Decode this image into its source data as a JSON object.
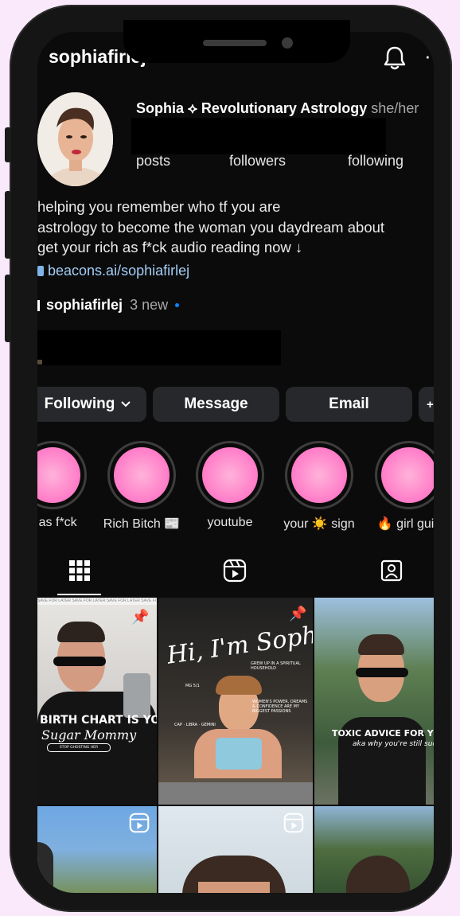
{
  "header": {
    "username": "sophiafirlej",
    "bell_icon": "bell-icon",
    "more_icon": "more-icon"
  },
  "profile": {
    "display_name": "Sophia ⟡ Revolutionary Astrology",
    "pronouns": "she/her",
    "stats": {
      "posts_label": "posts",
      "followers_label": "followers",
      "following_label": "following"
    },
    "bio_lines": [
      "helping you remember who tf you are",
      "astrology to become the woman you daydream about",
      "get your rich as f*ck audio reading now ↓"
    ],
    "link_text": "beacons.ai/sophiafirlej",
    "threads_handle": "sophiafirlej",
    "threads_new": "3 new"
  },
  "actions": {
    "following_label": "Following",
    "message_label": "Message",
    "email_label": "Email"
  },
  "highlights": [
    {
      "label": "h as f*ck"
    },
    {
      "label": "Rich Bitch 📰"
    },
    {
      "label": "youtube"
    },
    {
      "label": "your ☀️ sign"
    },
    {
      "label": "🔥 girl guid"
    }
  ],
  "tabs": [
    {
      "icon": "grid-icon",
      "active": true
    },
    {
      "icon": "reels-icon",
      "active": false
    },
    {
      "icon": "tagged-icon",
      "active": false
    }
  ],
  "posts": {
    "p1_ticker": "SAVE FOR LATER SAVE FOR LATER SAVE FOR LATER SAVE FOR LATER SAVE FOR LATER",
    "p1_headline": "BIRTH CHART IS YOUR",
    "p1_script": "Sugar Mommy",
    "p1_button": "STOP GHOSTING HER",
    "p2_script": "Hi, I'm Sophia.",
    "p2_note1": "GREW UP IN A SPIRITUAL HOUSEHOLD",
    "p2_note2": "MG 5/1",
    "p2_note3": "WOMEN'S POWER, DREAMS & CONFIDENCE ARE MY BIGGEST PASSIONS",
    "p2_note4": "CAP · LIBRA · GEMINI",
    "p3_headline": "TOXIC ADVICE FOR YOUR NORTH",
    "p3_sub": "aka why you're still suck."
  },
  "colors": {
    "background": "#0b0b0b",
    "link": "#a3cdf5",
    "accent_blue": "#0a84ff",
    "button_bg": "#26282b",
    "highlight_pink": "#ff77c6",
    "outer": "#f9e9fb"
  }
}
